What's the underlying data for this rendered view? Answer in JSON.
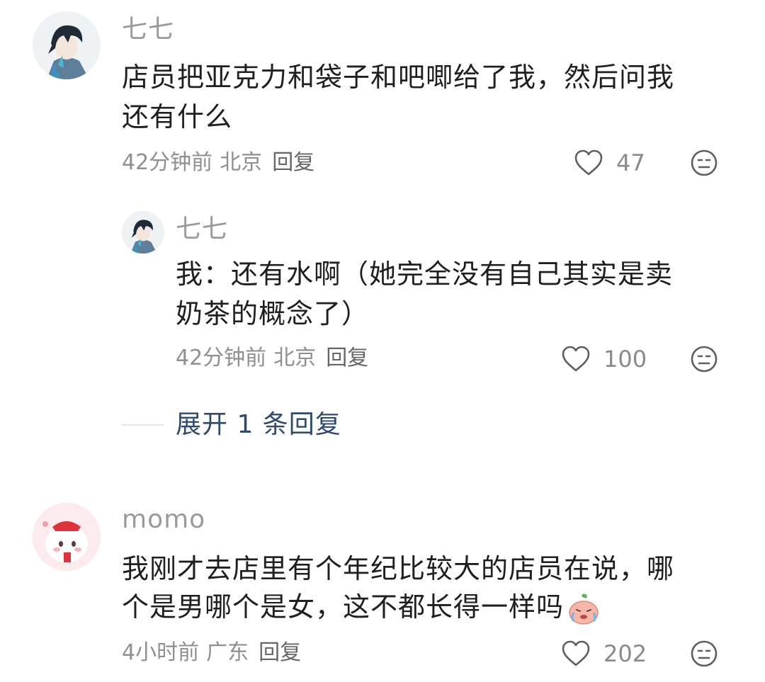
{
  "comments": [
    {
      "author": "七七",
      "text_line1": "店员把亚克力和袋子和吧唧给了我，然后问我",
      "text_line2": "还有什么",
      "time": "42分钟前",
      "location": "北京",
      "reply_label": "回复",
      "likes": "47"
    },
    {
      "author": "七七",
      "text_line1": "我：还有水啊（她完全没有自己其实是卖",
      "text_line2": "奶茶的概念了）",
      "time": "42分钟前",
      "location": "北京",
      "reply_label": "回复",
      "likes": "100",
      "is_reply": true
    },
    {
      "author": "momo",
      "text_line1": "我刚才去店里有个年纪比较大的店员在说，哪",
      "text_line2": "个是男哪个是女，这不都长得一样吗",
      "time": "4小时前",
      "location": "广东",
      "reply_label": "回复",
      "likes": "202",
      "emoji": "crying-peach-emoji"
    }
  ],
  "expand_replies": "展开 1 条回复",
  "icons": [
    "heart-outline-icon",
    "dislike-face-icon",
    "avatar-anime-boy",
    "avatar-pink-bunny"
  ],
  "colors": {
    "link": "#2e4a6e",
    "meta": "#8f8f8f",
    "text": "#1f1f1f"
  }
}
